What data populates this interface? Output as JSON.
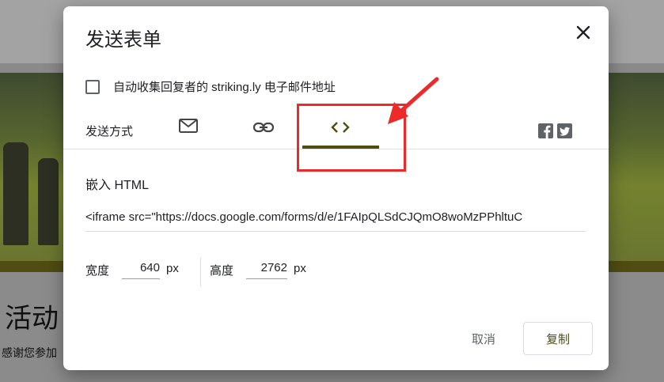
{
  "background": {
    "heading": "活动",
    "body_text": "感谢您参加"
  },
  "dialog": {
    "title": "发送表单",
    "collect_email_label": "自动收集回复者的 striking.ly 电子邮件地址",
    "send_via_label": "发送方式",
    "tabs": [
      {
        "name": "email",
        "icon": "mail-icon",
        "selected": false
      },
      {
        "name": "link",
        "icon": "link-icon",
        "selected": false
      },
      {
        "name": "embed",
        "icon": "code-icon",
        "selected": true
      }
    ],
    "social": [
      "facebook-icon",
      "twitter-icon"
    ],
    "embed_heading": "嵌入 HTML",
    "embed_code": "<iframe src=\"https://docs.google.com/forms/d/e/1FAIpQLSdCJQmO8woMzPPhltuC",
    "width_label": "宽度",
    "width_value": "640",
    "width_unit": "px",
    "height_label": "高度",
    "height_value": "2762",
    "height_unit": "px",
    "cancel_label": "取消",
    "copy_label": "复制"
  },
  "colors": {
    "accent": "#4f4d12",
    "annotation": "#ec2a2a"
  }
}
